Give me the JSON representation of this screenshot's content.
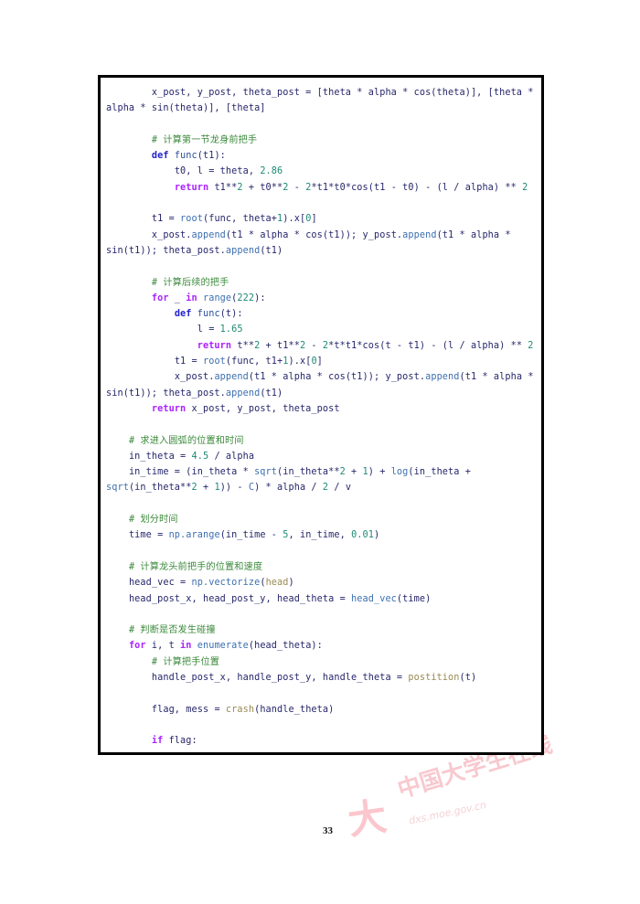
{
  "document": {
    "page_number": "33",
    "watermark": {
      "text_cn": "中国大学生在线",
      "url": "dxs.moe.gov.cn",
      "mark": "大",
      "color": "#f8c9cf"
    }
  },
  "code_block": {
    "language": "python",
    "border_color": "#000000",
    "background_color": "#ffffff",
    "colors": {
      "keyword": "#aa22ff",
      "def_keyword": "#2222cc",
      "comment": "#3c8a3c",
      "number": "#1d8a74",
      "function": "#2b4f9e",
      "builtin": "#3c6fb0",
      "user_function": "#9a8a52",
      "plain": "#26266b"
    },
    "lines": [
      "        x_post, y_post, theta_post = [theta * alpha * cos(theta)], [theta * alpha * sin(theta)], [theta]",
      "",
      "        # 计算第一节龙身前把手",
      "        def func(t1):",
      "            t0, l = theta, 2.86",
      "            return t1**2 + t0**2 - 2*t1*t0*cos(t1 - t0) - (l / alpha) ** 2",
      "",
      "        t1 = root(func, theta+1).x[0]",
      "        x_post.append(t1 * alpha * cos(t1)); y_post.append(t1 * alpha * sin(t1)); theta_post.append(t1)",
      "",
      "        # 计算后续的把手",
      "        for _ in range(222):",
      "            def func(t):",
      "                l = 1.65",
      "                return t**2 + t1**2 - 2*t*t1*cos(t - t1) - (l / alpha) ** 2",
      "            t1 = root(func, t1+1).x[0]",
      "            x_post.append(t1 * alpha * cos(t1)); y_post.append(t1 * alpha * sin(t1)); theta_post.append(t1)",
      "        return x_post, y_post, theta_post",
      "",
      "    # 求进入圆弧的位置和时间",
      "    in_theta = 4.5 / alpha",
      "    in_time = (in_theta * sqrt(in_theta**2 + 1) + log(in_theta + sqrt(in_theta**2 + 1)) - C) * alpha / 2 / v",
      "",
      "    # 划分时间",
      "    time = np.arange(in_time - 5, in_time, 0.01)",
      "",
      "    # 计算龙头前把手的位置和速度",
      "    head_vec = np.vectorize(head)",
      "    head_post_x, head_post_y, head_theta = head_vec(time)",
      "",
      "    # 判断是否发生碰撞",
      "    for i, t in enumerate(head_theta):",
      "        # 计算把手位置",
      "        handle_post_x, handle_post_y, handle_theta = postition(t)",
      "",
      "        flag, mess = crash(handle_theta)",
      "",
      "        if flag:"
    ],
    "html": "<span class=\"ind\">        </span><span class=\"nm\">x_post, y_post, theta_post = [theta * alpha * cos(theta)], [theta * alpha * sin(theta)], [theta]</span>\n\n<span class=\"ind\">        </span><span class=\"cmt\"># 计算第一节龙身前把手</span>\n<span class=\"ind\">        </span><span class=\"kwd\">def</span> <span class=\"fn\">func</span><span class=\"nm\">(t1):</span>\n<span class=\"ind\">            </span><span class=\"nm\">t0, l = theta, </span><span class=\"num\">2.86</span>\n<span class=\"ind\">            </span><span class=\"kw\">return</span><span class=\"nm\"> t1**</span><span class=\"num\">2</span><span class=\"nm\"> + t0**</span><span class=\"num\">2</span><span class=\"nm\"> - </span><span class=\"num\">2</span><span class=\"nm\">*t1*t0*cos(t1 - t0) - (l / alpha) ** </span><span class=\"num\">2</span>\n\n<span class=\"ind\">        </span><span class=\"nm\">t1 = </span><span class=\"bfn\">root</span><span class=\"nm\">(func, theta+</span><span class=\"num\">1</span><span class=\"nm\">).x[</span><span class=\"num\">0</span><span class=\"nm\">]</span>\n<span class=\"ind\">        </span><span class=\"nm\">x_post.</span><span class=\"bfn\">append</span><span class=\"nm\">(t1 * alpha * cos(t1)); y_post.</span><span class=\"bfn\">append</span><span class=\"nm\">(t1 * alpha * sin(t1)); theta_post.</span><span class=\"bfn\">append</span><span class=\"nm\">(t1)</span>\n\n<span class=\"ind\">        </span><span class=\"cmt\"># 计算后续的把手</span>\n<span class=\"ind\">        </span><span class=\"kw\">for</span><span class=\"nm\"> _ </span><span class=\"kw\">in</span> <span class=\"bfn\">range</span><span class=\"nm\">(</span><span class=\"num\">222</span><span class=\"nm\">):</span>\n<span class=\"ind\">            </span><span class=\"kwd\">def</span> <span class=\"fn\">func</span><span class=\"nm\">(t):</span>\n<span class=\"ind\">                </span><span class=\"nm\">l = </span><span class=\"num\">1.65</span>\n<span class=\"ind\">                </span><span class=\"kw\">return</span><span class=\"nm\"> t**</span><span class=\"num\">2</span><span class=\"nm\"> + t1**</span><span class=\"num\">2</span><span class=\"nm\"> - </span><span class=\"num\">2</span><span class=\"nm\">*t*t1*cos(t - t1) - (l / alpha) ** </span><span class=\"num\">2</span>\n<span class=\"ind\">            </span><span class=\"nm\">t1 = </span><span class=\"bfn\">root</span><span class=\"nm\">(func, t1+</span><span class=\"num\">1</span><span class=\"nm\">).x[</span><span class=\"num\">0</span><span class=\"nm\">]</span>\n<span class=\"ind\">            </span><span class=\"nm\">x_post.</span><span class=\"bfn\">append</span><span class=\"nm\">(t1 * alpha * cos(t1)); y_post.</span><span class=\"bfn\">append</span><span class=\"nm\">(t1 * alpha * sin(t1)); theta_post.</span><span class=\"bfn\">append</span><span class=\"nm\">(t1)</span>\n<span class=\"ind\">        </span><span class=\"kw\">return</span><span class=\"nm\"> x_post, y_post, theta_post</span>\n\n<span class=\"ind\">    </span><span class=\"cmt\"># 求进入圆弧的位置和时间</span>\n<span class=\"ind\">    </span><span class=\"nm\">in_theta = </span><span class=\"num\">4.5</span><span class=\"nm\"> / alpha</span>\n<span class=\"ind\">    </span><span class=\"nm\">in_time = (in_theta * </span><span class=\"bfn\">sqrt</span><span class=\"nm\">(in_theta**</span><span class=\"num\">2</span><span class=\"nm\"> + </span><span class=\"num\">1</span><span class=\"nm\">) + </span><span class=\"bfn\">log</span><span class=\"nm\">(in_theta + </span><span class=\"bfn\">sqrt</span><span class=\"nm\">(in_theta**</span><span class=\"num\">2</span><span class=\"nm\"> + </span><span class=\"num\">1</span><span class=\"nm\">)) - </span><span class=\"bfn\">C</span><span class=\"nm\">) * alpha / </span><span class=\"num\">2</span><span class=\"nm\"> / v</span>\n\n<span class=\"ind\">    </span><span class=\"cmt\"># 划分时间</span>\n<span class=\"ind\">    </span><span class=\"nm\">time = </span><span class=\"bfn\">np.arange</span><span class=\"nm\">(in_time - </span><span class=\"num\">5</span><span class=\"nm\">, in_time, </span><span class=\"num\">0.01</span><span class=\"nm\">)</span>\n\n<span class=\"ind\">    </span><span class=\"cmt\"># 计算龙头前把手的位置和速度</span>\n<span class=\"ind\">    </span><span class=\"nm\">head_vec = </span><span class=\"bfn\">np.vectorize</span><span class=\"nm\">(</span><span class=\"usr\">head</span><span class=\"nm\">)</span>\n<span class=\"ind\">    </span><span class=\"nm\">head_post_x, head_post_y, head_theta = </span><span class=\"bfn\">head_vec</span><span class=\"nm\">(time)</span>\n\n<span class=\"ind\">    </span><span class=\"cmt\"># 判断是否发生碰撞</span>\n<span class=\"ind\">    </span><span class=\"kw\">for</span><span class=\"nm\"> i, t </span><span class=\"kw\">in</span> <span class=\"bfn\">enumerate</span><span class=\"nm\">(head_theta):</span>\n<span class=\"ind\">        </span><span class=\"cmt\"># 计算把手位置</span>\n<span class=\"ind\">        </span><span class=\"nm\">handle_post_x, handle_post_y, handle_theta = </span><span class=\"usr\">postition</span><span class=\"nm\">(t)</span>\n\n<span class=\"ind\">        </span><span class=\"nm\">flag, mess = </span><span class=\"usr\">crash</span><span class=\"nm\">(handle_theta)</span>\n\n<span class=\"ind\">        </span><span class=\"kw\">if</span><span class=\"nm\"> flag:</span>"
  }
}
